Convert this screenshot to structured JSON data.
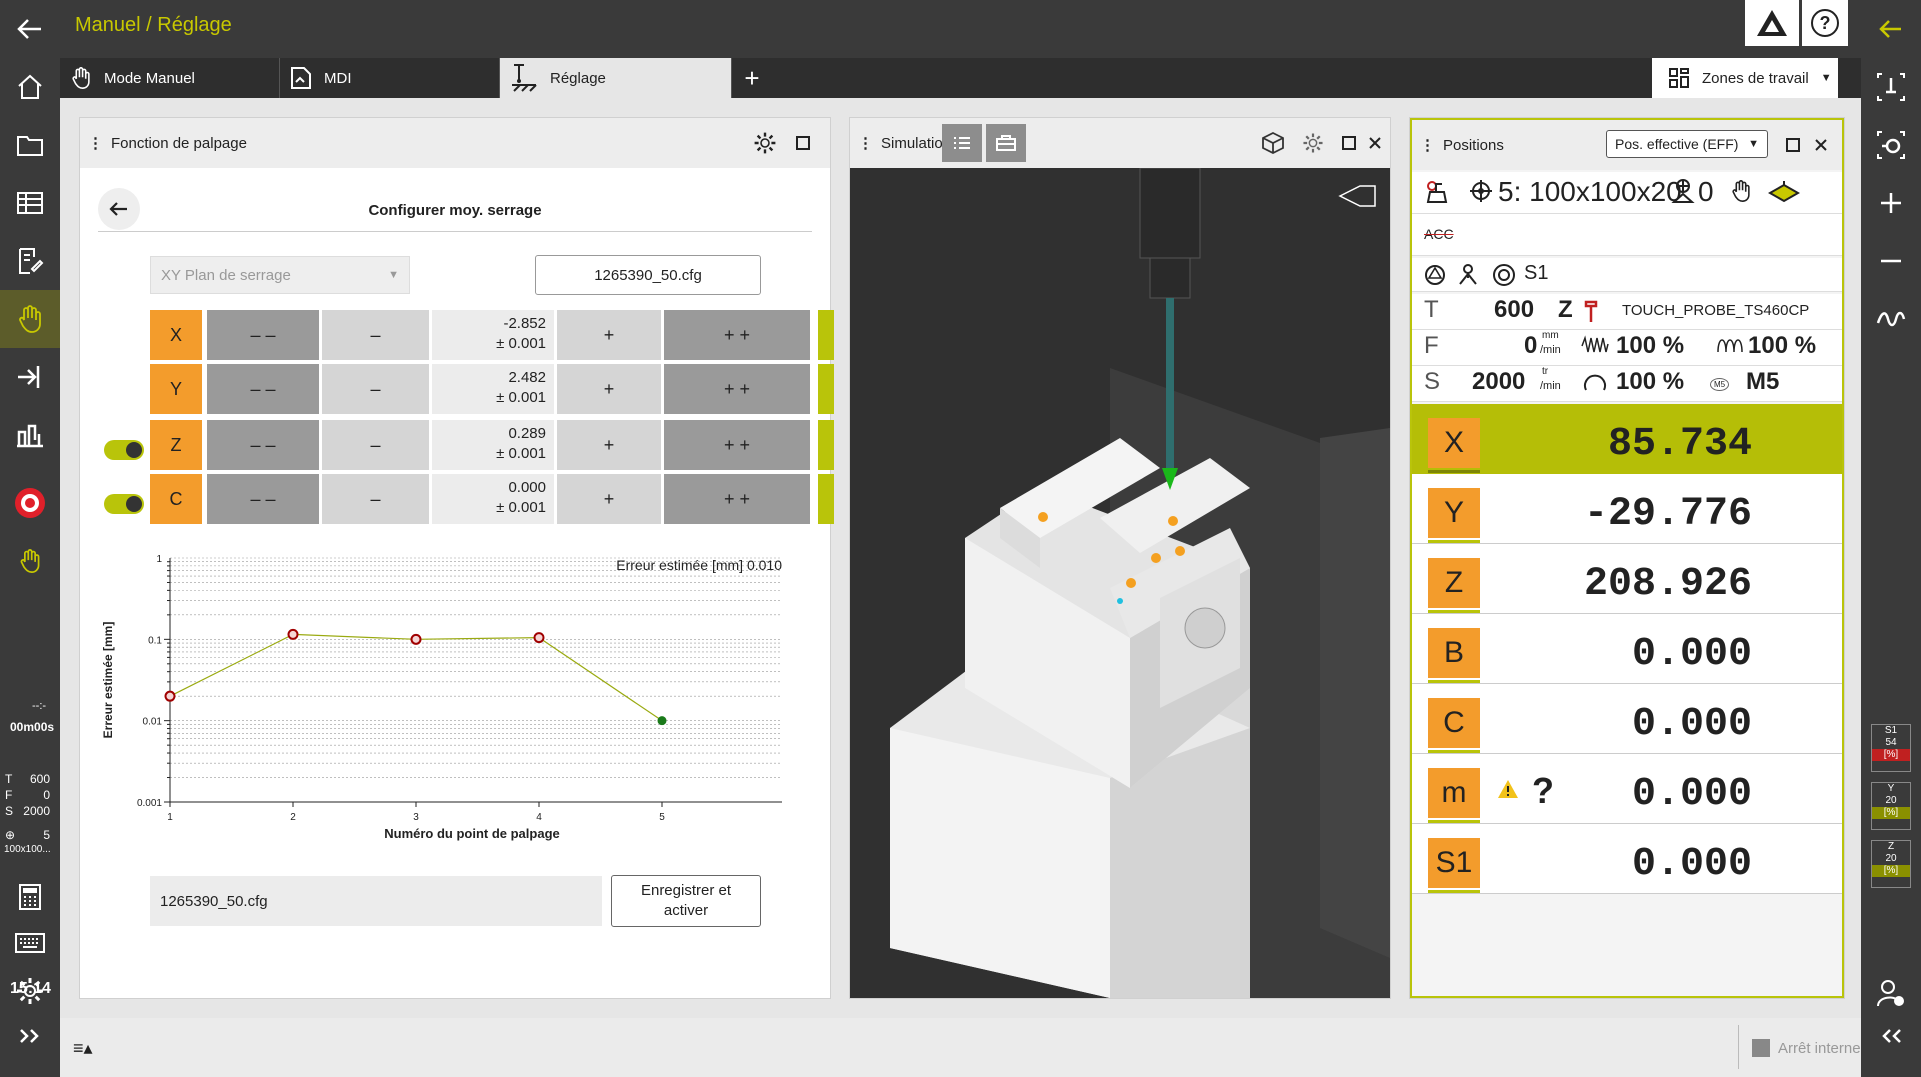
{
  "header": {
    "title": "Manuel / Réglage"
  },
  "tabs": [
    {
      "label": "Mode Manuel"
    },
    {
      "label": "MDI"
    },
    {
      "label": "Réglage"
    }
  ],
  "work_zones_label": "Zones de travail",
  "left_status": {
    "timer_dash": "--:-",
    "timer": "00m00s",
    "t_label": "T",
    "t_value": "600",
    "f_label": "F",
    "f_value": "0",
    "s_label": "S",
    "s_value": "2000",
    "preset_value": "5",
    "preset_name": "100x100...",
    "clock": "15:14"
  },
  "right_gauges": [
    {
      "l1": "S1",
      "l2": "54",
      "l3": "[%]"
    },
    {
      "l1": "Y",
      "l2": "20",
      "l3": "[%]"
    },
    {
      "l1": "Z",
      "l2": "20",
      "l3": "[%]"
    }
  ],
  "probe_panel": {
    "title": "Fonction de palpage",
    "subtitle": "Configurer moy. serrage",
    "plane_select": "XY Plan de serrage",
    "cfg_file": "1265390_50.cfg",
    "axes": [
      {
        "label": "X",
        "value": "-2.852",
        "tol": "± 0.001",
        "toggle": false
      },
      {
        "label": "Y",
        "value": "2.482",
        "tol": "± 0.001",
        "toggle": false
      },
      {
        "label": "Z",
        "value": "0.289",
        "tol": "± 0.001",
        "toggle": true
      },
      {
        "label": "C",
        "value": "0.000",
        "tol": "± 0.001",
        "toggle": true
      }
    ],
    "btn_mm": "– –",
    "btn_m": "–",
    "btn_p": "+",
    "btn_pp": "+ +",
    "cfg_bottom": "1265390_50.cfg",
    "save_label": "Enregistrer et activer"
  },
  "chart_data": {
    "type": "line",
    "title": "Erreur estimée [mm] 0.010",
    "xlabel": "Numéro du point de palpage",
    "ylabel": "Erreur estimée [mm]",
    "yscale": "log",
    "ylim": [
      0.001,
      1
    ],
    "xlim": [
      1,
      5
    ],
    "x_ticks": [
      "1",
      "2",
      "3",
      "4",
      "5"
    ],
    "y_ticks": [
      "1",
      "0.1",
      "0.01",
      "0.001"
    ],
    "x": [
      1,
      2,
      3,
      4,
      5
    ],
    "values": [
      0.02,
      0.115,
      0.1,
      0.105,
      0.01
    ],
    "point_colors": [
      "#a00000",
      "#a00000",
      "#a00000",
      "#a00000",
      "#1a7a1a"
    ],
    "line_color": "#9aaa10",
    "grid": true
  },
  "simulation_panel": {
    "title": "Simulation"
  },
  "positions_panel": {
    "title": "Positions",
    "mode_select": "Pos. effective (EFF)",
    "preset": "5: 100x100x20",
    "preset_count": "0",
    "acc": "ACC",
    "spindle": "S1",
    "t_label": "T",
    "t_value": "600",
    "t_axis": "Z",
    "tool_name": "TOUCH_PROBE_TS460CP",
    "f_label": "F",
    "f_value": "0",
    "f_unit_top": "mm",
    "f_unit_bottom": "/min",
    "f_override": "100 %",
    "rapid_override": "100 %",
    "s_label": "S",
    "s_value": "2000",
    "s_unit_top": "tr",
    "s_unit_bottom": "/min",
    "s_override": "100 %",
    "m_func": "M5",
    "ms_badge": "M5",
    "axes": [
      {
        "label": "X",
        "value": "85.734",
        "highlight": true
      },
      {
        "label": "Y",
        "value": "-29.776",
        "highlight": false
      },
      {
        "label": "Z",
        "value": "208.926",
        "highlight": false
      },
      {
        "label": "B",
        "value": "0.000",
        "highlight": false
      },
      {
        "label": "C",
        "value": "0.000",
        "highlight": false
      },
      {
        "label": "m",
        "value": "0.000",
        "highlight": false,
        "warning": true,
        "unknown": "?"
      },
      {
        "label": "S1",
        "value": "0.000",
        "highlight": false
      }
    ]
  },
  "bottom": {
    "stop_label": "Arrêt interne"
  },
  "colors": {
    "accent": "#c8c800",
    "axis_orange": "#f39c2c",
    "highlight_green": "#b5be07"
  }
}
